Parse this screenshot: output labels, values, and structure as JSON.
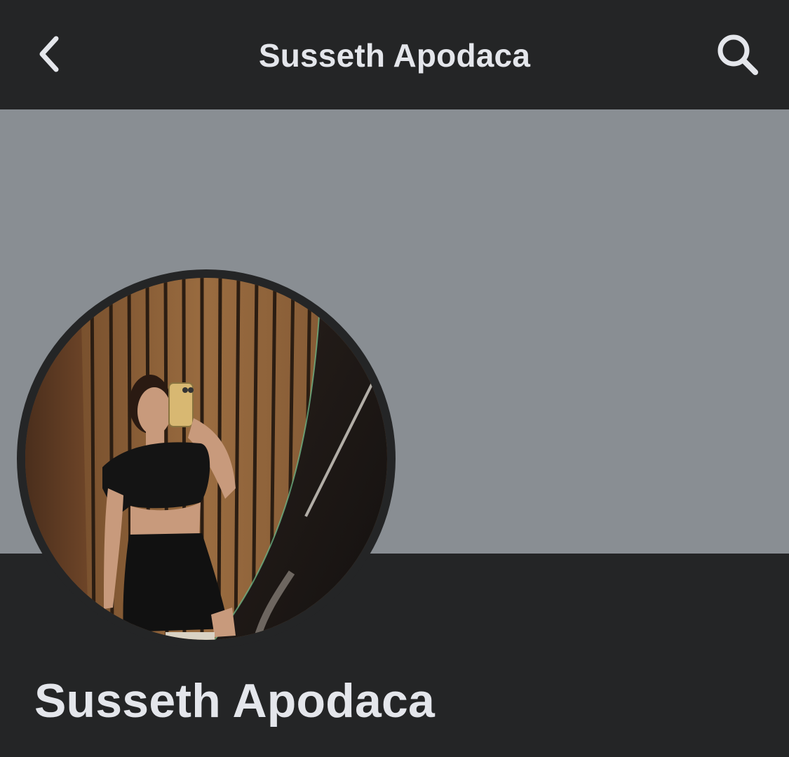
{
  "header": {
    "title": "Susseth Apodaca",
    "back_icon": "chevron-left-icon",
    "search_icon": "search-icon"
  },
  "profile": {
    "name": "Susseth Apodaca",
    "avatar_subject": "mirror selfie photo"
  },
  "colors": {
    "header_bg": "#242526",
    "cover_bg": "#898e93",
    "text": "#e4e6eb",
    "body_bg": "#242526"
  }
}
